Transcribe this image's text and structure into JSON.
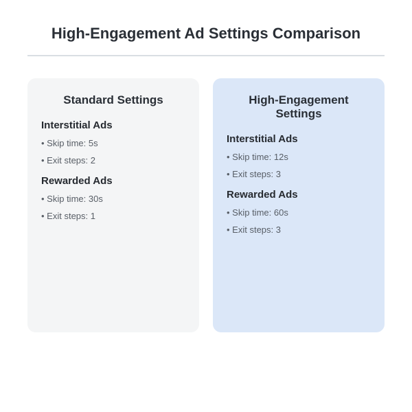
{
  "title": "High-Engagement Ad Settings Comparison",
  "cards": [
    {
      "key": "standard",
      "heading": "Standard Settings",
      "sections": [
        {
          "name": "Interstitial Ads",
          "items": [
            "Skip time: 5s",
            "Exit steps: 2"
          ]
        },
        {
          "name": "Rewarded Ads",
          "items": [
            "Skip time: 30s",
            "Exit steps: 1"
          ]
        }
      ]
    },
    {
      "key": "high",
      "heading": "High-Engagement Settings",
      "sections": [
        {
          "name": "Interstitial Ads",
          "items": [
            "Skip time: 12s",
            "Exit steps: 3"
          ]
        },
        {
          "name": "Rewarded Ads",
          "items": [
            "Skip time: 60s",
            "Exit steps: 3"
          ]
        }
      ]
    }
  ]
}
